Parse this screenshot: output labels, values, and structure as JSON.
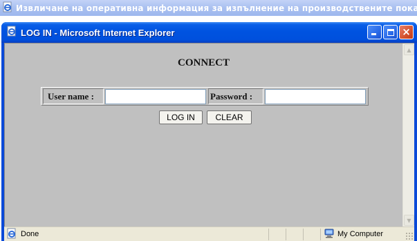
{
  "background_window": {
    "title": "Извличане на оперативна информация за изпълнение на производствените показатели"
  },
  "window": {
    "title": "LOG IN - Microsoft Internet Explorer",
    "buttons": {
      "minimize": "minimize",
      "maximize": "maximize",
      "close": "×"
    }
  },
  "page": {
    "heading": "CONNECT",
    "form": {
      "username_label": "User name :",
      "username_value": "",
      "password_label": "Password :",
      "password_value": "",
      "login_button": "LOG IN",
      "clear_button": "CLEAR"
    }
  },
  "statusbar": {
    "status_text": "Done",
    "zone_text": "My Computer"
  },
  "colors": {
    "titlebar_blue": "#0053e0",
    "client_gray": "#c0c0c0",
    "statusbar_bg": "#ece9d8",
    "close_red": "#d4522e"
  },
  "icons": [
    "ie-page-icon",
    "minimize-icon",
    "maximize-icon",
    "close-icon",
    "scroll-up-icon",
    "scroll-down-icon",
    "computer-zone-icon",
    "resize-grip-icon"
  ]
}
